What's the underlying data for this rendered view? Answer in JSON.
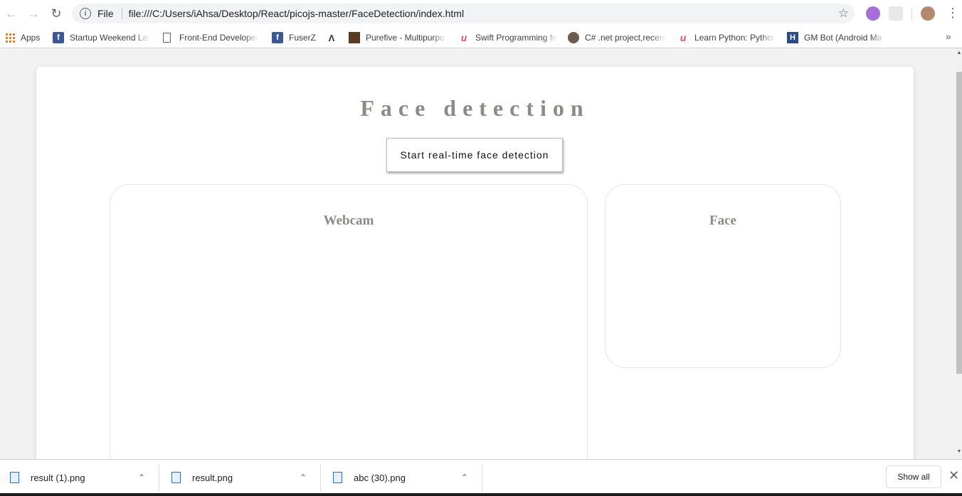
{
  "browser": {
    "scheme_label": "File",
    "url": "file:///C:/Users/iAhsa/Desktop/React/picojs-master/FaceDetection/index.html",
    "back_icon": "back-arrow-icon",
    "forward_icon": "forward-arrow-icon",
    "reload_icon": "reload-icon"
  },
  "bookmarks": [
    {
      "label": "Apps",
      "icon": "apps-grid-icon"
    },
    {
      "label": "Startup Weekend Lah",
      "icon": "facebook-icon"
    },
    {
      "label": "Front-End Developer",
      "icon": "page-icon"
    },
    {
      "label": "FuserZ",
      "icon": "facebook-icon"
    },
    {
      "label": "",
      "icon": "bookmark-logo-icon"
    },
    {
      "label": "Purefive - Multipurpo",
      "icon": "site-favicon"
    },
    {
      "label": "Swift Programming fo",
      "icon": "udemy-icon"
    },
    {
      "label": "C# .net project,recent",
      "icon": "site-favicon"
    },
    {
      "label": "Learn Python: Python",
      "icon": "udemy-icon"
    },
    {
      "label": "GM Bot (Android Ma",
      "icon": "h-favicon"
    }
  ],
  "page": {
    "title": "Face detection",
    "start_button": "Start real-time face detection",
    "webcam_heading": "Webcam",
    "face_heading": "Face"
  },
  "downloads": [
    {
      "filename": "result (1).png"
    },
    {
      "filename": "result.png"
    },
    {
      "filename": "abc (30).png"
    }
  ],
  "downloads_bar": {
    "show_all": "Show all"
  },
  "colors": {
    "heading": "#8a8a86",
    "facebook": "#3b5998",
    "udemy": "#ec5252"
  }
}
